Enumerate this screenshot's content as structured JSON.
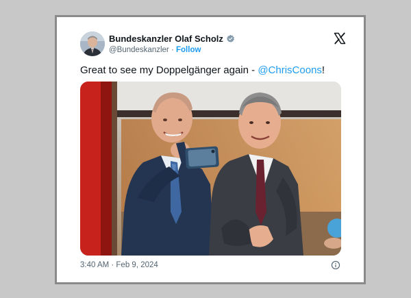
{
  "tweet": {
    "author_name": "Bundeskanzler Olaf Scholz",
    "handle": "@Bundeskanzler",
    "separator": "·",
    "follow_label": "Follow",
    "text_before": "Great to see my Doppelgänger again - ",
    "mention": "@ChrisCoons",
    "text_after": "!",
    "timestamp": "3:40 AM · Feb 9, 2024"
  },
  "icons": {
    "verified": "verified-badge-icon",
    "platform": "x-logo-icon",
    "info": "info-icon"
  },
  "colors": {
    "link": "#1d9bf0",
    "text": "#0f1419",
    "muted": "#536471"
  }
}
